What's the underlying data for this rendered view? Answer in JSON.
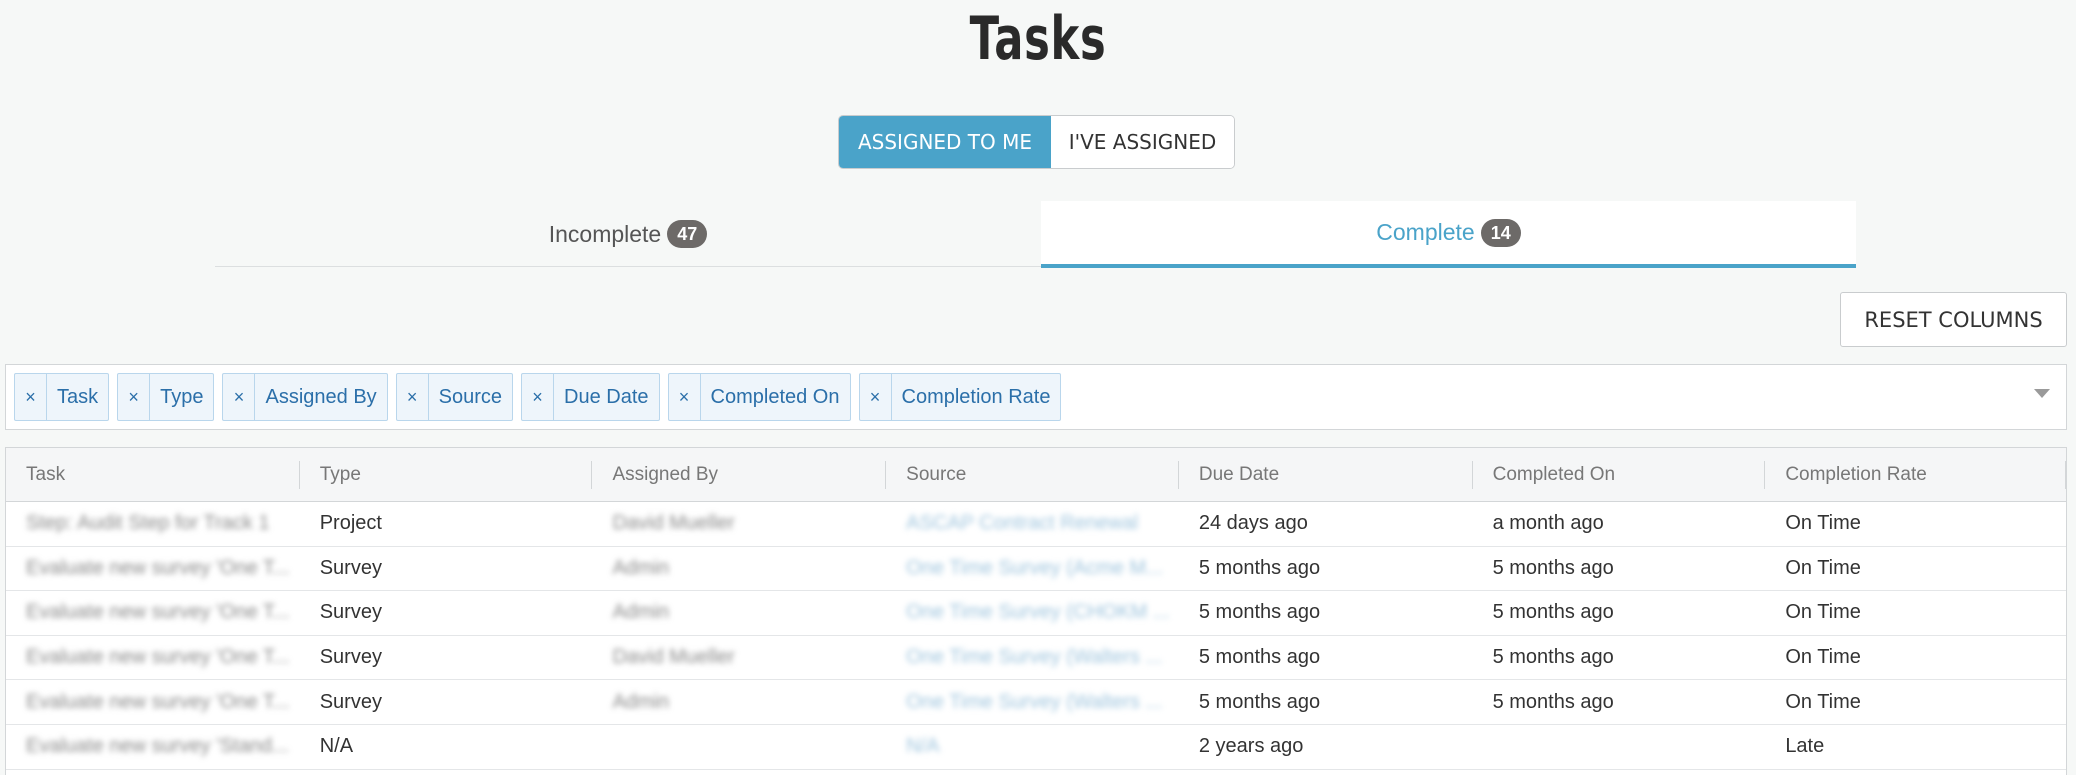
{
  "page": {
    "title": "Tasks"
  },
  "toggle": {
    "assigned_to_me": "ASSIGNED TO ME",
    "ive_assigned": "I'VE ASSIGNED"
  },
  "tabs": [
    {
      "label": "Incomplete",
      "count": "47"
    },
    {
      "label": "Complete",
      "count": "14"
    }
  ],
  "reset_columns": "RESET COLUMNS",
  "column_chips": [
    {
      "remove": "×",
      "label": "Task"
    },
    {
      "remove": "×",
      "label": "Type"
    },
    {
      "remove": "×",
      "label": "Assigned By"
    },
    {
      "remove": "×",
      "label": "Source"
    },
    {
      "remove": "×",
      "label": "Due Date"
    },
    {
      "remove": "×",
      "label": "Completed On"
    },
    {
      "remove": "×",
      "label": "Completion Rate"
    }
  ],
  "grid": {
    "headers": [
      "Task",
      "Type",
      "Assigned By",
      "Source",
      "Due Date",
      "Completed On",
      "Completion Rate"
    ],
    "rows": [
      {
        "task": "Step: Audit Step for Track 1",
        "type": "Project",
        "assigned_by": "David Mueller",
        "source": "ASCAP Contract Renewal",
        "due": "24 days ago",
        "completed": "a month ago",
        "rate": "On Time"
      },
      {
        "task": "Evaluate new survey 'One T...",
        "type": "Survey",
        "assigned_by": "Admin",
        "source": "One Time Survey (Acme M...",
        "due": "5 months ago",
        "completed": "5 months ago",
        "rate": "On Time"
      },
      {
        "task": "Evaluate new survey 'One T...",
        "type": "Survey",
        "assigned_by": "Admin",
        "source": "One Time Survey (CHOKM ...",
        "due": "5 months ago",
        "completed": "5 months ago",
        "rate": "On Time"
      },
      {
        "task": "Evaluate new survey 'One T...",
        "type": "Survey",
        "assigned_by": "David Mueller",
        "source": "One Time Survey (Walters ...",
        "due": "5 months ago",
        "completed": "5 months ago",
        "rate": "On Time"
      },
      {
        "task": "Evaluate new survey 'One T...",
        "type": "Survey",
        "assigned_by": "Admin",
        "source": "One Time Survey (Walters ...",
        "due": "5 months ago",
        "completed": "5 months ago",
        "rate": "On Time"
      },
      {
        "task": "Evaluate new survey 'Stand...",
        "type": "N/A",
        "assigned_by": "",
        "source": "N/A",
        "due": "2 years ago",
        "completed": "",
        "rate": "Late"
      }
    ]
  },
  "colors": {
    "accent": "#4aa3c9",
    "badge": "#6d6a68",
    "chip_text": "#2b6fa9"
  }
}
